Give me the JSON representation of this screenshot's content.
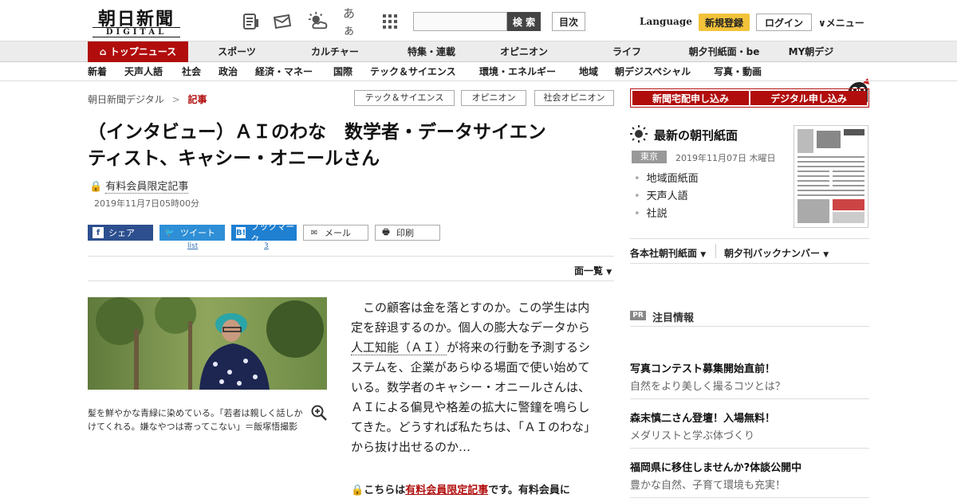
{
  "header": {
    "logo_main": "朝日新聞",
    "logo_sub": "DIGITAL",
    "font_toggle": "あぁ",
    "search_placeholder": "",
    "search_button": "検 索",
    "toc_button": "目次",
    "language": "Language",
    "signup": "新規登録",
    "login": "ログイン",
    "menu": "メニュー"
  },
  "gnav": [
    "トップニュース",
    "スポーツ",
    "カルチャー",
    "特集・連載",
    "オピニオン",
    "ライフ",
    "朝夕刊紙面・be",
    "MY朝デジ"
  ],
  "snav": [
    "新着",
    "天声人語",
    "社会",
    "政治",
    "経済・マネー",
    "国際",
    "テック＆サイエンス",
    "環境・エネルギー",
    "地域",
    "朝デジスペシャル",
    "写真・動画"
  ],
  "breadcrumb": {
    "root": "朝日新聞デジタル",
    "sep": ">",
    "current": "記事"
  },
  "tags": [
    "テック＆サイエンス",
    "オピニオン",
    "社会オピニオン"
  ],
  "subscribe": [
    "新聞宅配申し込み",
    "デジタル申し込み"
  ],
  "article": {
    "title_line1": "（インタビュー）ＡＩのわな　数学者・データサイエン",
    "title_line2": "ティスト、キャシー・オニールさん",
    "paid_label": "有料会員限定記事",
    "date": "2019年11月7日05時00分",
    "share": {
      "facebook": "シェア",
      "twitter": "ツイート",
      "twitter_count": "list",
      "hatena": "ブックマーク",
      "hatena_count": "3",
      "mail": "メール",
      "print": "印刷"
    },
    "menlist": "面一覧",
    "caption": "髪を鮮やかな青緑に染めている。「若者は親しく話しかけてくれる。嫌なやつは寄ってこない」＝飯塚悟撮影",
    "lead_1": "この顧客は金を落とすのか。この学生は内定を辞退するのか。個人の膨大なデータから",
    "lead_link": "人工知能（ＡＩ）",
    "lead_2": "が将来の行動を予測するシステムを、企業があらゆる場面で使い始めている。数学者のキャシー・オニールさんは、ＡＩによる偏見や格差の拡大に警鐘を鳴らしてきた。どうすれば私たちは、「ＡＩのわな」から抜け出せるのか…",
    "paid_note_1": "こちらは",
    "paid_note_link": "有料会員限定記事",
    "paid_note_2": "です。有料会員に"
  },
  "sidebar": {
    "paper_title": "最新の朝刊紙面",
    "region": "東京",
    "paper_date": "2019年11月07日 木曜日",
    "links": [
      "地域面紙面",
      "天声人語",
      "社説"
    ],
    "backnum": [
      "各本社朝刊紙面",
      "朝夕刊バックナンバー"
    ],
    "pr_badge": "PR",
    "attention": "注目情報",
    "ads": [
      {
        "title": "写真コンテスト募集開始直前！",
        "sub": "自然をより美しく撮るコツとは？"
      },
      {
        "title": "森末慎二さん登壇！入場無料！",
        "sub": "メダリストと学ぶ体づくり"
      },
      {
        "title": "福岡県に移住しませんか?体談公開中",
        "sub": "豊かな自然、子育て環境も充実！"
      }
    ]
  },
  "colors": {
    "brand_red": "#b10d0d",
    "signup_yellow": "#f2c33a",
    "facebook": "#2d4f8f",
    "twitter": "#2f8fd6",
    "hatena": "#1f7fd0"
  }
}
